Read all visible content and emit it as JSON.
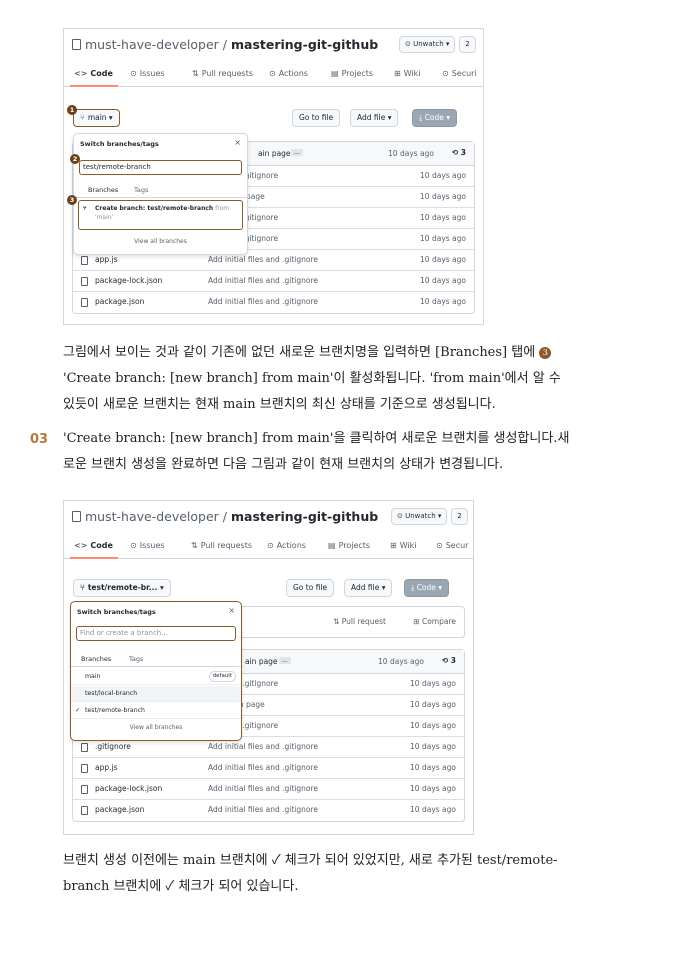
{
  "shot1": {
    "owner": "must-have-developer",
    "repo": "mastering-git-github",
    "watch": "⊙ Unwatch ▾",
    "count": "2",
    "tabs": [
      "Code",
      "Issues",
      "Pull requests",
      "Actions",
      "Projects",
      "Wiki",
      "Securi"
    ],
    "tab_icons": [
      "<>",
      "⊙",
      "⇅",
      "⊙",
      "▤",
      "⊞",
      "⊙"
    ],
    "branch_button": "main ▾",
    "go_to_file": "Go to file",
    "add_file": "Add file ▾",
    "code": "⤓ Code ▾",
    "commit_msg": "ain page",
    "commit_badge": "...",
    "commit_age": "10 days ago",
    "commit_count": "3",
    "popup": {
      "title": "Switch branches/tags",
      "close": "×",
      "input_value": "test/remote-branch",
      "tab_branches": "Branches",
      "tab_tags": "Tags",
      "create_line1": "Create branch: test/remote-branch",
      "create_from": "from",
      "create_line2": "'main'",
      "view_all": "View all branches"
    },
    "rows": [
      {
        "name": "",
        "msg": "files and .gitignore",
        "age": "10 days ago"
      },
      {
        "name": "",
        "msg": "e to main page",
        "age": "10 days ago"
      },
      {
        "name": "",
        "msg": "files and .gitignore",
        "age": "10 days ago"
      },
      {
        "name": "",
        "msg": "files and .gitignore",
        "age": "10 days ago"
      },
      {
        "name": "app.js",
        "msg": "Add initial files and .gitignore",
        "age": "10 days ago"
      },
      {
        "name": "package-lock.json",
        "msg": "Add initial files and .gitignore",
        "age": "10 days ago"
      },
      {
        "name": "package.json",
        "msg": "Add initial files and .gitignore",
        "age": "10 days ago"
      }
    ],
    "badges": [
      "1",
      "2",
      "3"
    ]
  },
  "text1": {
    "line1": "그림에서 보이는 것과 같이 기존에 없던 새로운 브랜치명을 입력하면 [Branches] 탭에",
    "marker": "3",
    "line2": "'Create branch: [new branch] from main'이 활성화됩니다. 'from main'에서 알 수",
    "line3": "있듯이 새로운 브랜치는 현재 main 브랜치의 최신 상태를 기준으로 생성됩니다."
  },
  "step": {
    "number": "03",
    "line1": "'Create branch: [new branch] from main'을 클릭하여 새로운 브랜치를 생성합니다.새",
    "line2": "로운 브랜치 생성을 완료하면 다음 그림과 같이 현재 브랜치의 상태가 변경됩니다."
  },
  "shot2": {
    "owner": "must-have-developer",
    "repo": "mastering-git-github",
    "watch": "⊙ Unwatch ▾",
    "count": "2",
    "tabs": [
      "Code",
      "Issues",
      "Pull requests",
      "Actions",
      "Projects",
      "Wiki",
      "Secur"
    ],
    "tab_icons": [
      "<>",
      "⊙",
      "⇅",
      "⊙",
      "▤",
      "⊞",
      "⊙"
    ],
    "branch_button": "test/remote-br... ▾",
    "go_to_file": "Go to file",
    "add_file": "Add file ▾",
    "code": "⤓ Code ▾",
    "pull_request": "Pull request",
    "compare": "Compare",
    "commit_msg": "ain page",
    "commit_badge": "...",
    "commit_age": "10 days ago",
    "commit_count": "3",
    "popup": {
      "title": "Switch branches/tags",
      "close": "×",
      "input_placeholder": "Find or create a branch...",
      "tab_branches": "Branches",
      "tab_tags": "Tags",
      "branches": [
        {
          "name": "main",
          "tag": "default",
          "checked": false
        },
        {
          "name": "test/local-branch",
          "tag": "",
          "checked": false
        },
        {
          "name": "test/remote-branch",
          "tag": "",
          "checked": true
        }
      ],
      "view_all": "View all branches"
    },
    "rows": [
      {
        "name": "",
        "msg": "files and .gitignore",
        "age": "10 days ago"
      },
      {
        "name": "",
        "msg": "e to main page",
        "age": "10 days ago"
      },
      {
        "name": "",
        "msg": "files and .gitignore",
        "age": "10 days ago"
      },
      {
        "name": ".gitignore",
        "msg": "Add initial files and .gitignore",
        "age": "10 days ago"
      },
      {
        "name": "app.js",
        "msg": "Add initial files and .gitignore",
        "age": "10 days ago"
      },
      {
        "name": "package-lock.json",
        "msg": "Add initial files and .gitignore",
        "age": "10 days ago"
      },
      {
        "name": "package.json",
        "msg": "Add initial files and .gitignore",
        "age": "10 days ago"
      }
    ]
  },
  "text2": {
    "line1": "브랜치 생성 이전에는 main 브랜치에 ✓ 체크가 되어 있었지만, 새로 추가된 test/remote-",
    "line2": "branch 브랜치에 ✓ 체크가 되어 있습니다."
  },
  "footer": "",
  "colors": {
    "accent": "#8a5a2b",
    "step_number": "#b5793b",
    "border": "#d0d7de"
  }
}
